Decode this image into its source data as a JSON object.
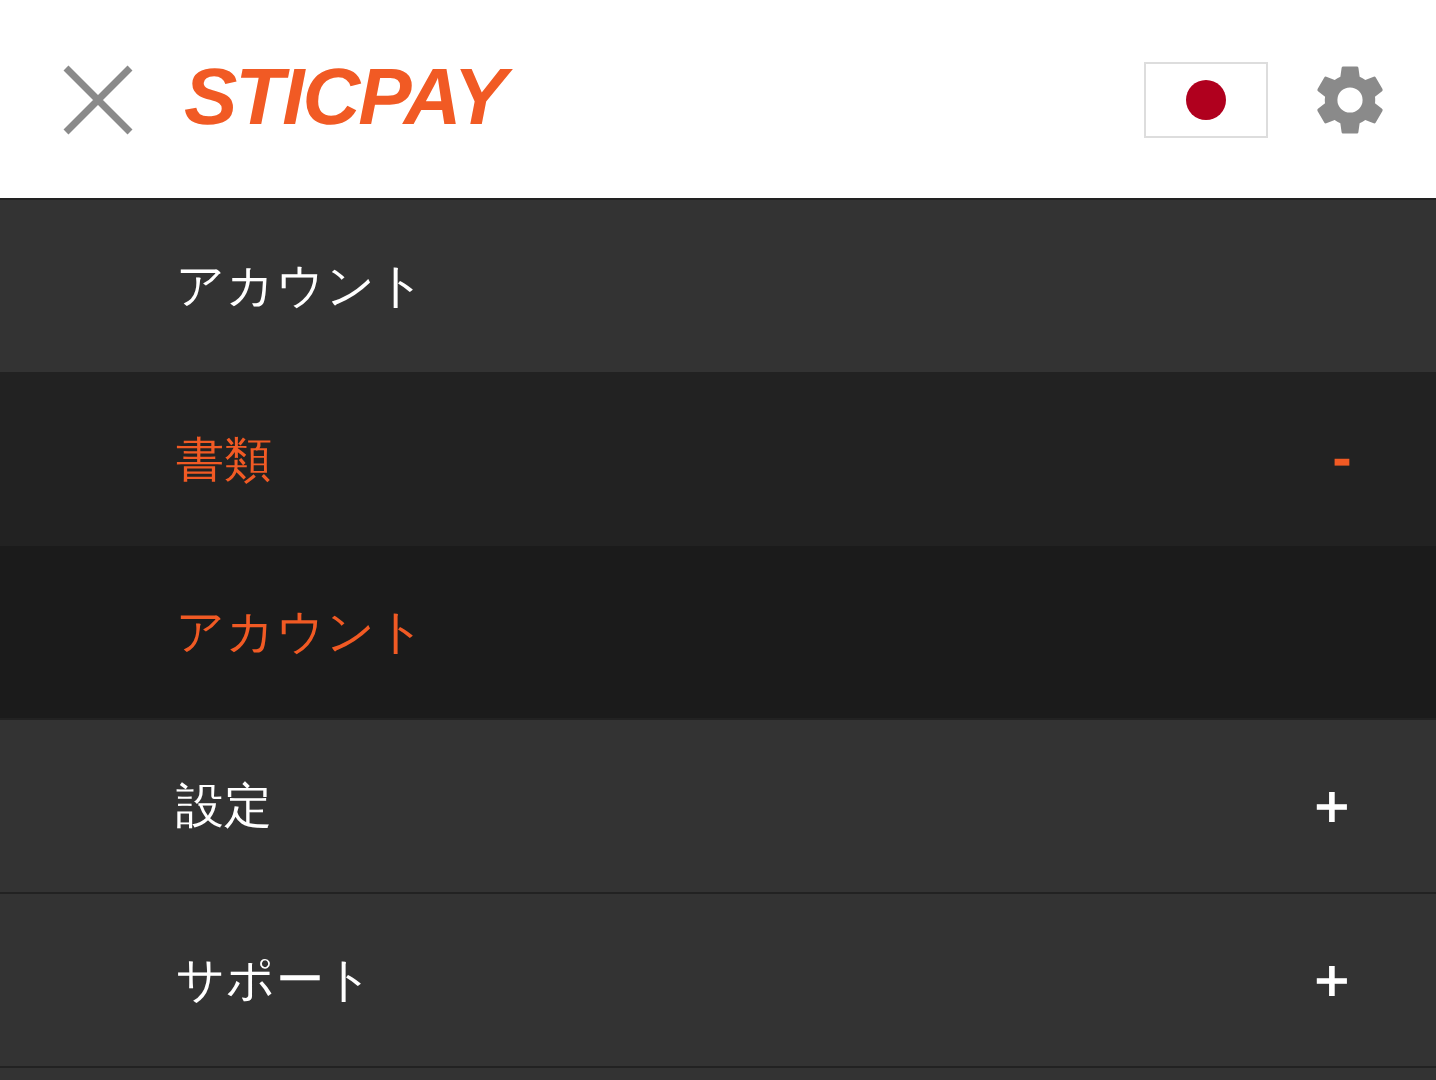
{
  "header": {
    "logo": "STICPAY"
  },
  "menu": [
    {
      "label": "アカウント",
      "expanded": false
    },
    {
      "label": "書類",
      "expanded": true,
      "toggle": "-",
      "children": [
        {
          "label": "アカウント",
          "selected": true
        }
      ]
    },
    {
      "label": "設定",
      "expanded": false,
      "toggle": "+"
    },
    {
      "label": "サポート",
      "expanded": false,
      "toggle": "+"
    }
  ]
}
